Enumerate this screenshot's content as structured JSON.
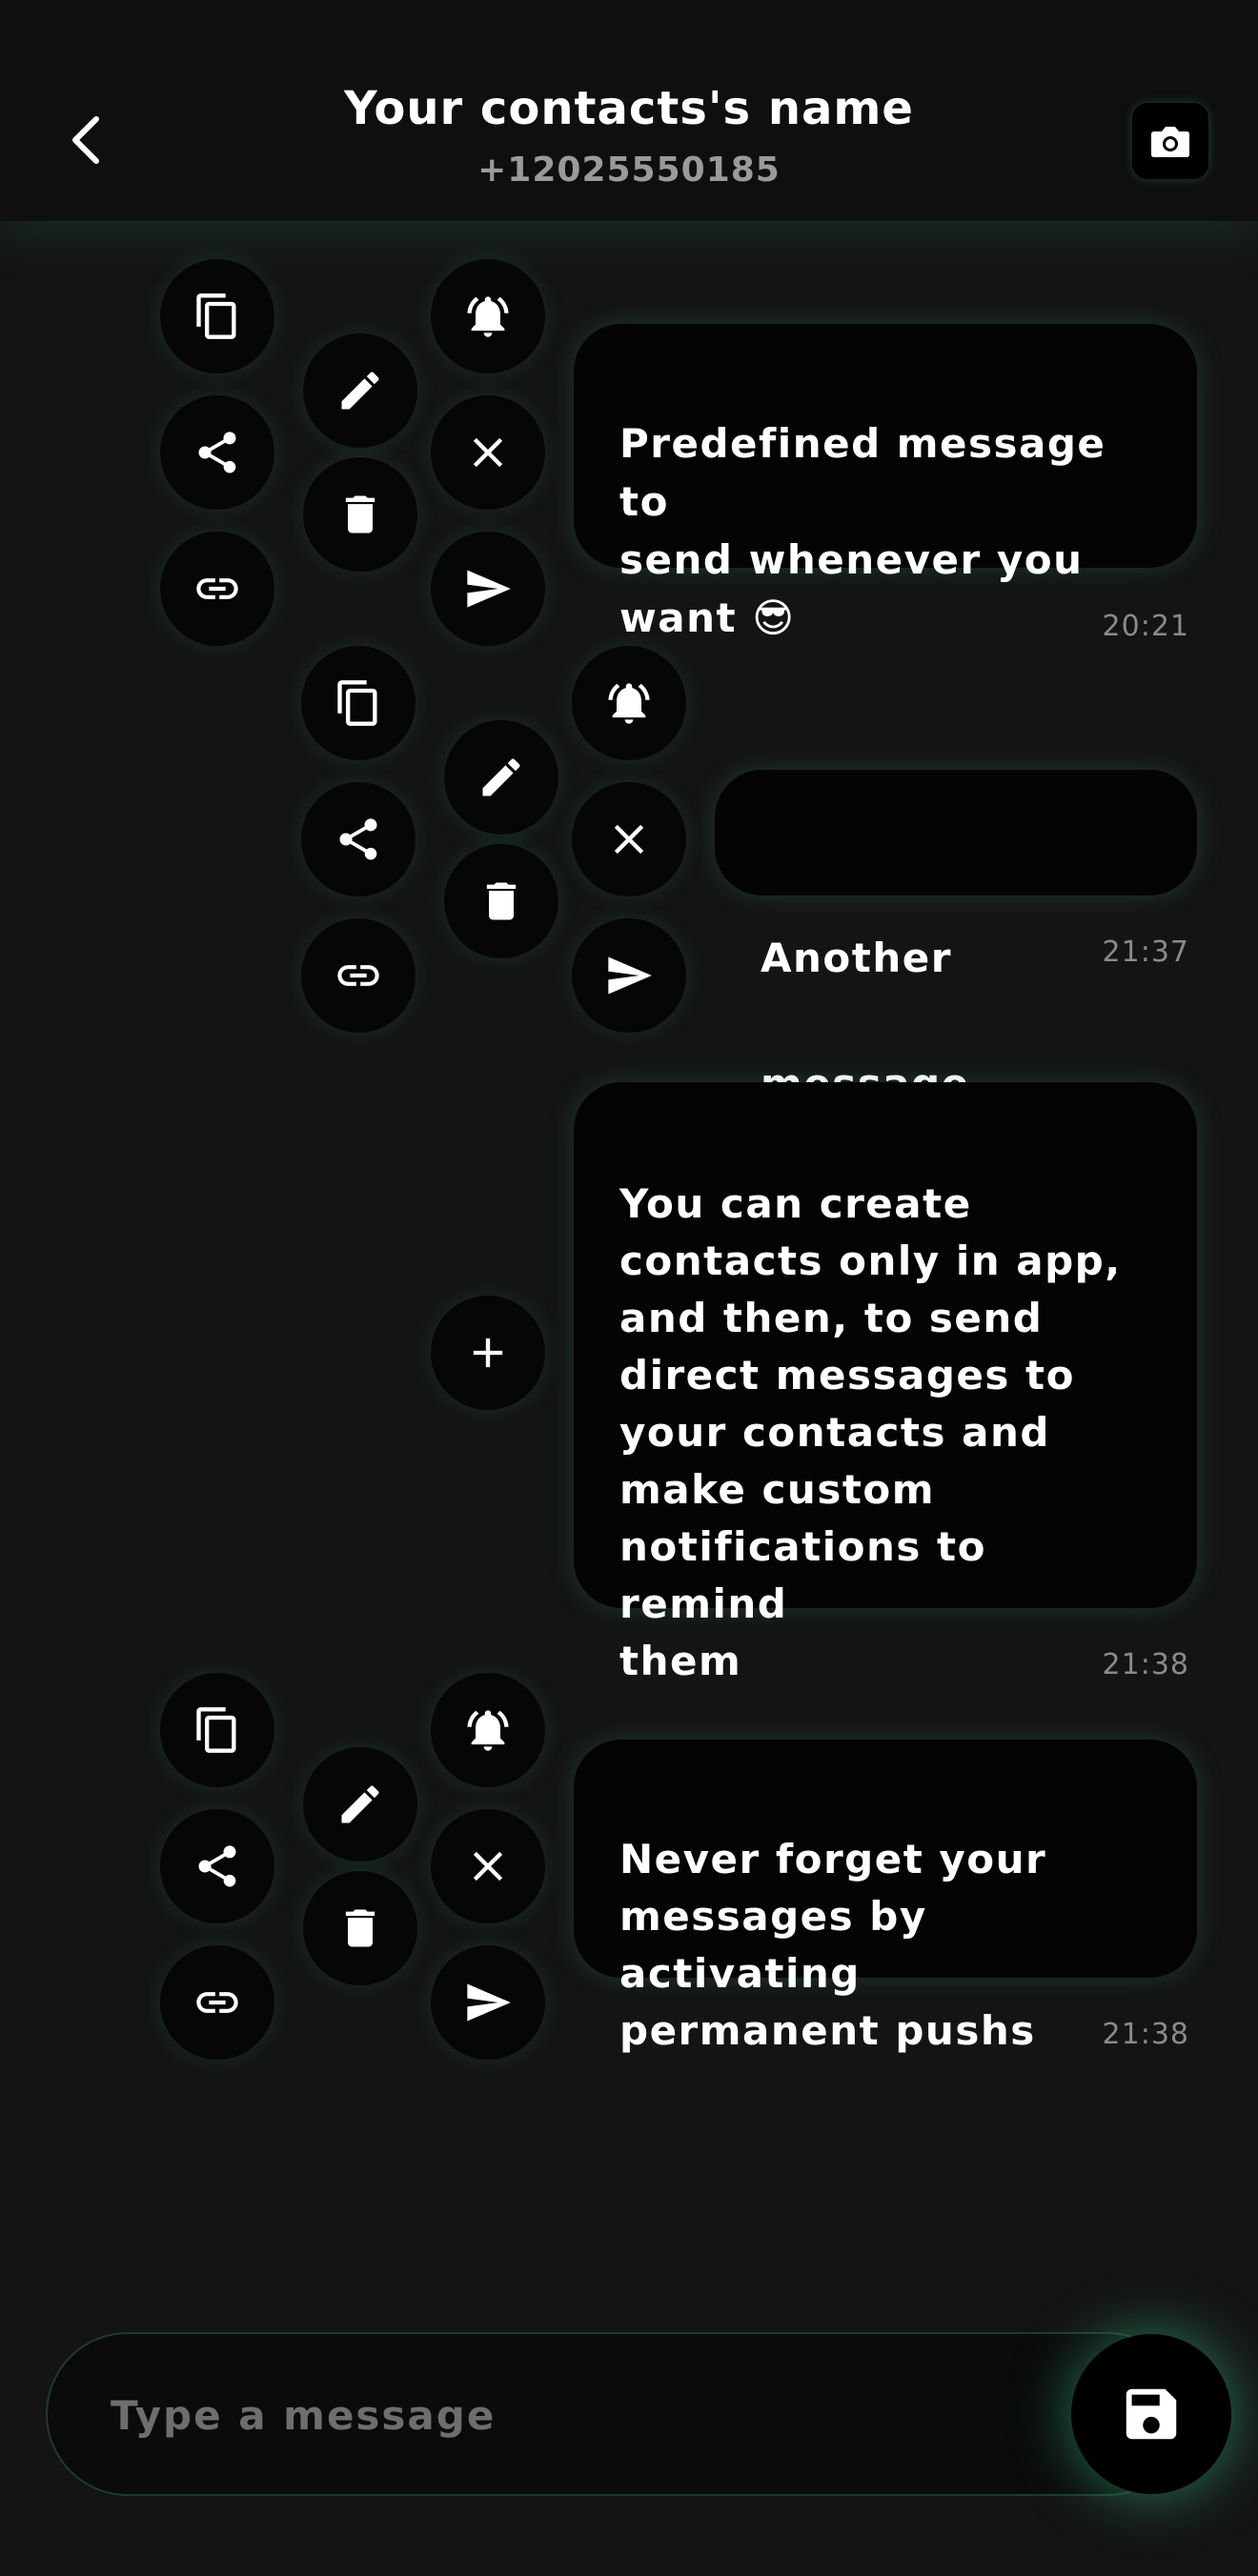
{
  "header": {
    "title": "Your contacts's name",
    "phone": "+12025550185"
  },
  "messages": [
    {
      "text": "Predefined message to\nsend whenever you\nwant 😎",
      "time": "20:21"
    },
    {
      "text": "Another message",
      "time": "21:37"
    },
    {
      "text": "You can create\ncontacts only in app,\nand then, to send\ndirect messages to\nyour contacts and\nmake custom\nnotifications to remind\nthem",
      "time": "21:38"
    },
    {
      "text": "Never forget your\nmessages by activating\npermanent pushs",
      "time": "21:38"
    }
  ],
  "action_icons": [
    "copy-icon",
    "share-icon",
    "link-icon",
    "edit-icon",
    "delete-icon",
    "bell-icon",
    "close-icon",
    "send-icon"
  ],
  "composer": {
    "placeholder": "Type a message",
    "save_icon": "save-icon"
  },
  "colors": {
    "background": "#141414",
    "bubble": "#040404",
    "glow": "#3caa78",
    "timestamp": "#8a8a8a"
  }
}
